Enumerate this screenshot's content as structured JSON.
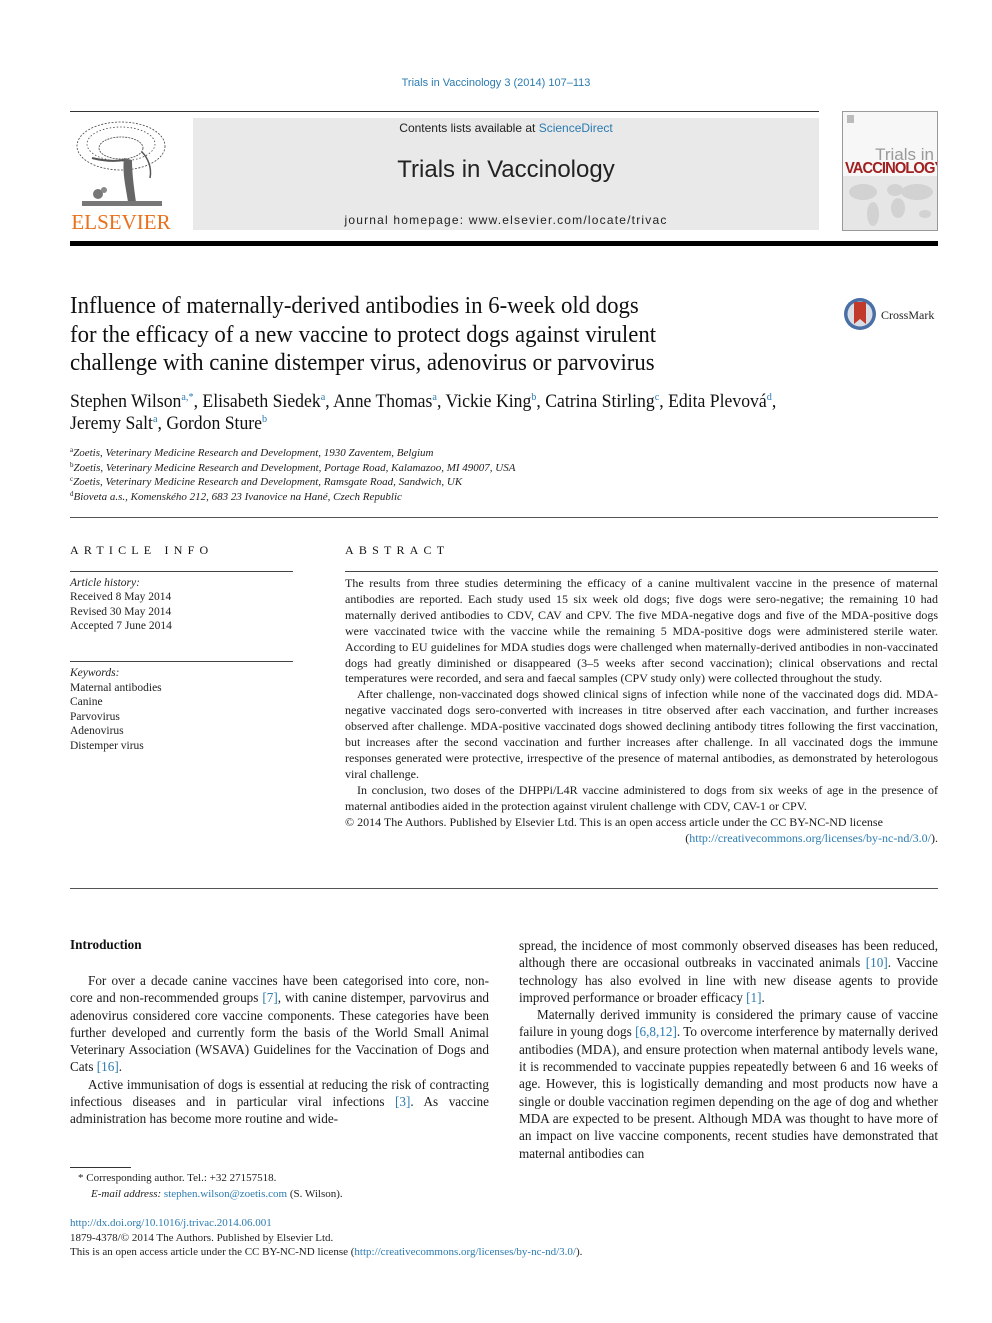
{
  "running_head": "Trials in Vaccinology 3 (2014) 107–113",
  "masthead": {
    "contents_prefix": "Contents lists available at ",
    "contents_link": "ScienceDirect",
    "journal_title": "Trials in Vaccinology",
    "homepage": "journal homepage: www.elsevier.com/locate/trivac",
    "publisher_logo_text": "ELSEVIER",
    "cover_line1": "Trials in",
    "cover_line2": "VACCINOLOGY",
    "crossmark_label": "CrossMark"
  },
  "colors": {
    "link": "#2b7bb0",
    "elsevier_orange": "#e9711c",
    "cover_red": "#a11f1f",
    "crossmark_red": "#c0392b",
    "crossmark_blue": "#4a6fa5"
  },
  "article": {
    "title_lines": [
      "Influence of maternally-derived antibodies in 6-week old dogs",
      "for the efficacy of a new vaccine to protect dogs against virulent",
      "challenge with canine distemper virus, adenovirus or parvovirus"
    ],
    "authors": [
      {
        "name": "Stephen Wilson",
        "sup": "a,*",
        "sep": ", "
      },
      {
        "name": "Elisabeth Siedek",
        "sup": "a",
        "sep": ", "
      },
      {
        "name": "Anne Thomas",
        "sup": "a",
        "sep": ", "
      },
      {
        "name": "Vickie King",
        "sup": "b",
        "sep": ", "
      },
      {
        "name": "Catrina Stirling",
        "sup": "c",
        "sep": ", "
      },
      {
        "name": "Edita Plevová",
        "sup": "d",
        "sep": ","
      },
      {
        "name": "Jeremy Salt",
        "sup": "a",
        "sep": ", "
      },
      {
        "name": "Gordon Sture",
        "sup": "b",
        "sep": ""
      }
    ],
    "affiliations": [
      {
        "mark": "a",
        "text": "Zoetis, Veterinary Medicine Research and Development, 1930 Zaventem, Belgium"
      },
      {
        "mark": "b",
        "text": "Zoetis, Veterinary Medicine Research and Development, Portage Road, Kalamazoo, MI 49007, USA"
      },
      {
        "mark": "c",
        "text": "Zoetis, Veterinary Medicine Research and Development, Ramsgate Road, Sandwich, UK"
      },
      {
        "mark": "d",
        "text": "Bioveta a.s., Komenského 212, 683 23 Ivanovice na Hané, Czech Republic"
      }
    ]
  },
  "article_info": {
    "heading": "ARTICLE INFO",
    "history_label": "Article history:",
    "history": [
      "Received 8 May 2014",
      "Revised 30 May 2014",
      "Accepted 7 June 2014"
    ],
    "keywords_label": "Keywords:",
    "keywords": [
      "Maternal antibodies",
      "Canine",
      "Parvovirus",
      "Adenovirus",
      "Distemper virus"
    ]
  },
  "abstract": {
    "heading": "ABSTRACT",
    "paragraphs": [
      "The results from three studies determining the efficacy of a canine multivalent vaccine in the presence of maternal antibodies are reported. Each study used 15 six week old dogs; five dogs were sero-negative; the remaining 10 had maternally derived antibodies to CDV, CAV and CPV. The five MDA-negative dogs and five of the MDA-positive dogs were vaccinated twice with the vaccine while the remaining 5 MDA-positive dogs were administered sterile water. According to EU guidelines for MDA studies dogs were challenged when maternally-derived antibodies in non-vaccinated dogs had greatly diminished or disappeared (3–5 weeks after second vaccination); clinical observations and rectal temperatures were recorded, and sera and faecal samples (CPV study only) were collected throughout the study.",
      "After challenge, non-vaccinated dogs showed clinical signs of infection while none of the vaccinated dogs did. MDA-negative vaccinated dogs sero-converted with increases in titre observed after each vaccination, and further increases observed after challenge. MDA-positive vaccinated dogs showed declining antibody titres following the first vaccination, but increases after the second vaccination and further increases after challenge. In all vaccinated dogs the immune responses generated were protective, irrespective of the presence of maternal antibodies, as demonstrated by heterologous viral challenge.",
      "In conclusion, two doses of the DHPPi/L4R vaccine administered to dogs from six weeks of age in the presence of maternal antibodies aided in the protection against virulent challenge with CDV, CAV-1 or CPV."
    ],
    "copyright": "© 2014 The Authors. Published by Elsevier Ltd. This is an open access article under the CC BY-NC-ND license",
    "license_open": "(",
    "license_url": "http://creativecommons.org/licenses/by-nc-nd/3.0/",
    "license_close": ")."
  },
  "body": {
    "intro_heading": "Introduction",
    "left": {
      "p1_a": "For over a decade canine vaccines have been categorised into core, non-core and non-recommended groups ",
      "p1_ref1": "[7]",
      "p1_b": ", with canine distemper, parvovirus and adenovirus considered core vaccine components. These categories have been further developed and currently form the basis of the World Small Animal Veterinary Association (WSAVA) Guidelines for the Vaccination of Dogs and Cats ",
      "p1_ref2": "[16]",
      "p1_c": ".",
      "p2_a": "Active immunisation of dogs is essential at reducing the risk of contracting infectious diseases and in particular viral infections ",
      "p2_ref1": "[3]",
      "p2_b": ". As vaccine administration has become more routine and wide-"
    },
    "right": {
      "p1_a": "spread, the incidence of most commonly observed diseases has been reduced, although there are occasional outbreaks in vaccinated animals ",
      "p1_ref1": "[10]",
      "p1_b": ". Vaccine technology has also evolved in line with new disease agents to provide improved performance or broader efficacy ",
      "p1_ref2": "[1]",
      "p1_c": ".",
      "p2_a": "Maternally derived immunity is considered the primary cause of vaccine failure in young dogs ",
      "p2_ref1": "[6,8,12]",
      "p2_b": ". To overcome interference by maternally derived antibodies (MDA), and ensure protection when maternal antibody levels wane, it is recommended to vaccinate puppies repeatedly between 6 and 16 weeks of age. However, this is logistically demanding and most products now have a single or double vaccination regimen depending on the age of dog and whether MDA are expected to be present. Although MDA was thought to have more of an impact on live vaccine components, recent studies have demonstrated that maternal antibodies can"
    }
  },
  "footnotes": {
    "corresponding_mark": "*",
    "corresponding": "Corresponding author. Tel.: +32 27157518.",
    "email_label": "E-mail address: ",
    "email": "stephen.wilson@zoetis.com",
    "email_suffix": " (S. Wilson).",
    "doi": "http://dx.doi.org/10.1016/j.trivac.2014.06.001",
    "issn_line": "1879-4378/© 2014 The Authors. Published by Elsevier Ltd.",
    "oa_prefix": "This is an open access article under the CC BY-NC-ND license (",
    "oa_url": "http://creativecommons.org/licenses/by-nc-nd/3.0/",
    "oa_suffix": ")."
  }
}
